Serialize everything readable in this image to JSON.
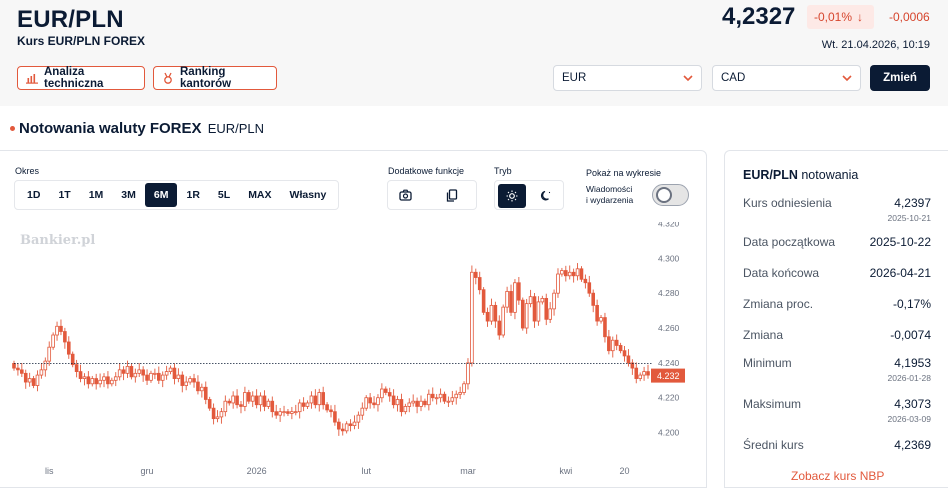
{
  "header": {
    "title": "EUR/PLN",
    "subtitle": "Kurs EUR/PLN FOREX",
    "price": "4,2327",
    "change_pct": "-0,01%",
    "change_abs": "-0,0006",
    "datetime": "Wt. 21.04.2026, 10:19",
    "btn_analysis": "Analiza techniczna",
    "btn_ranking": "Ranking kantorów",
    "select_from": "EUR",
    "select_to": "CAD",
    "btn_change": "Zmień"
  },
  "section": {
    "title": "Notowania waluty FOREX",
    "subtitle": "EUR/PLN"
  },
  "controls": {
    "period_label": "Okres",
    "periods": [
      "1D",
      "1T",
      "1M",
      "3M",
      "6M",
      "1R",
      "5L",
      "MAX",
      "Własny"
    ],
    "active_period": "6M",
    "functions_label": "Dodatkowe funkcje",
    "mode_label": "Tryb",
    "show_label": "Pokaż na wykresie",
    "toggle_label_line1": "Wiadomości",
    "toggle_label_line2": "i wydarzenia",
    "toggle_on": false
  },
  "chart": {
    "watermark": "Bankier.pl"
  },
  "chart_data": {
    "type": "candlestick",
    "yticks": [
      4.2,
      4.22,
      4.24,
      4.26,
      4.28,
      4.3,
      4.32
    ],
    "ytick_labels": [
      "4.200",
      "4.220",
      "4.240",
      "4.260",
      "4.280",
      "4.300",
      "4.320"
    ],
    "ylim": [
      4.19,
      4.32
    ],
    "xtick_labels": [
      "lis",
      "gru",
      "2026",
      "lut",
      "mar",
      "kwi",
      "20"
    ],
    "reference_level": 4.2397,
    "current_value_label": "4.232",
    "current_value": 4.2327,
    "up_color": "#ffffff",
    "down_color": "#e2593c",
    "closes": [
      4.237,
      4.236,
      4.234,
      4.229,
      4.231,
      4.227,
      4.233,
      4.236,
      4.241,
      4.249,
      4.256,
      4.261,
      4.258,
      4.252,
      4.245,
      4.239,
      4.235,
      4.231,
      4.232,
      4.228,
      4.231,
      4.228,
      4.23,
      4.232,
      4.228,
      4.23,
      4.232,
      4.236,
      4.234,
      4.238,
      4.232,
      4.234,
      4.236,
      4.233,
      4.23,
      4.234,
      4.234,
      4.23,
      4.233,
      4.235,
      4.237,
      4.231,
      4.233,
      4.227,
      4.229,
      4.231,
      4.229,
      4.224,
      4.226,
      4.219,
      4.214,
      4.208,
      4.209,
      4.212,
      4.218,
      4.217,
      4.221,
      4.216,
      4.215,
      4.223,
      4.218,
      4.221,
      4.216,
      4.221,
      4.215,
      4.218,
      4.212,
      4.21,
      4.212,
      4.212,
      4.211,
      4.212,
      4.212,
      4.217,
      4.215,
      4.217,
      4.221,
      4.216,
      4.223,
      4.216,
      4.213,
      4.212,
      4.206,
      4.202,
      4.201,
      4.205,
      4.204,
      4.206,
      4.21,
      4.214,
      4.22,
      4.217,
      4.216,
      4.22,
      4.225,
      4.223,
      4.221,
      4.216,
      4.219,
      4.212,
      4.215,
      4.217,
      4.218,
      4.215,
      4.218,
      4.216,
      4.222,
      4.22,
      4.22,
      4.222,
      4.218,
      4.218,
      4.22,
      4.222,
      4.223,
      4.228,
      4.24,
      4.292,
      4.289,
      4.282,
      4.269,
      4.264,
      4.273,
      4.264,
      4.256,
      4.272,
      4.281,
      4.269,
      4.286,
      4.276,
      4.26,
      4.274,
      4.278,
      4.264,
      4.275,
      4.277,
      4.265,
      4.271,
      4.28,
      4.291,
      4.293,
      4.29,
      4.292,
      4.29,
      4.294,
      4.288,
      4.286,
      4.28,
      4.273,
      4.264,
      4.266,
      4.255,
      4.247,
      4.253,
      4.25,
      4.247,
      4.244,
      4.24,
      4.237,
      4.231,
      4.233,
      4.235,
      4.233
    ]
  },
  "stats": {
    "title_bold": "EUR/PLN",
    "title_rest": "notowania",
    "rows": [
      {
        "label": "Kurs odniesienia",
        "value": "4,2397",
        "date": "2025-10-21"
      },
      {
        "label": "Data początkowa",
        "value": "2025-10-22"
      },
      {
        "label": "Data końcowa",
        "value": "2026-04-21"
      },
      {
        "label": "Zmiana proc.",
        "value": "-0,17%"
      },
      {
        "label": "Zmiana",
        "value": "-0,0074"
      },
      {
        "label": "Minimum",
        "value": "4,1953",
        "date": "2026-01-28"
      },
      {
        "label": "Maksimum",
        "value": "4,3073",
        "date": "2026-03-09"
      },
      {
        "label": "Średni kurs",
        "value": "4,2369"
      }
    ],
    "link": "Zobacz kurs NBP"
  },
  "colors": {
    "accent": "#e2593c",
    "dark": "#0b1b34",
    "negative": "#d6452d"
  }
}
